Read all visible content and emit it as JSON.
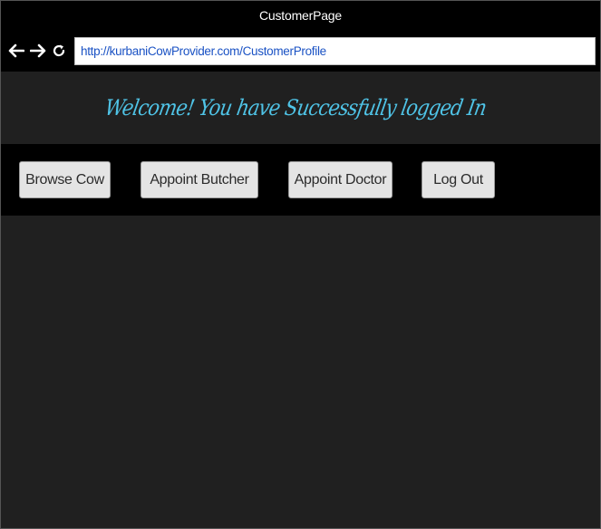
{
  "window": {
    "title": "CustomerPage"
  },
  "navbar": {
    "back_icon": "arrow-left-icon",
    "forward_icon": "arrow-right-icon",
    "reload_icon": "reload-icon",
    "url": "http://kurbaniCowProvider.com/CustomerProfile"
  },
  "header": {
    "welcome": "Welcome! You have Successfully logged In"
  },
  "menu": {
    "items": [
      {
        "label": "Browse Cow"
      },
      {
        "label": "Appoint Butcher"
      },
      {
        "label": "Appoint Doctor"
      },
      {
        "label": "Log Out"
      }
    ]
  },
  "colors": {
    "chrome": "#000000",
    "page_background": "#202020",
    "welcome_text": "#4fc3e6",
    "url_text": "#1a52c4",
    "button_face": "#e4e4e4"
  }
}
